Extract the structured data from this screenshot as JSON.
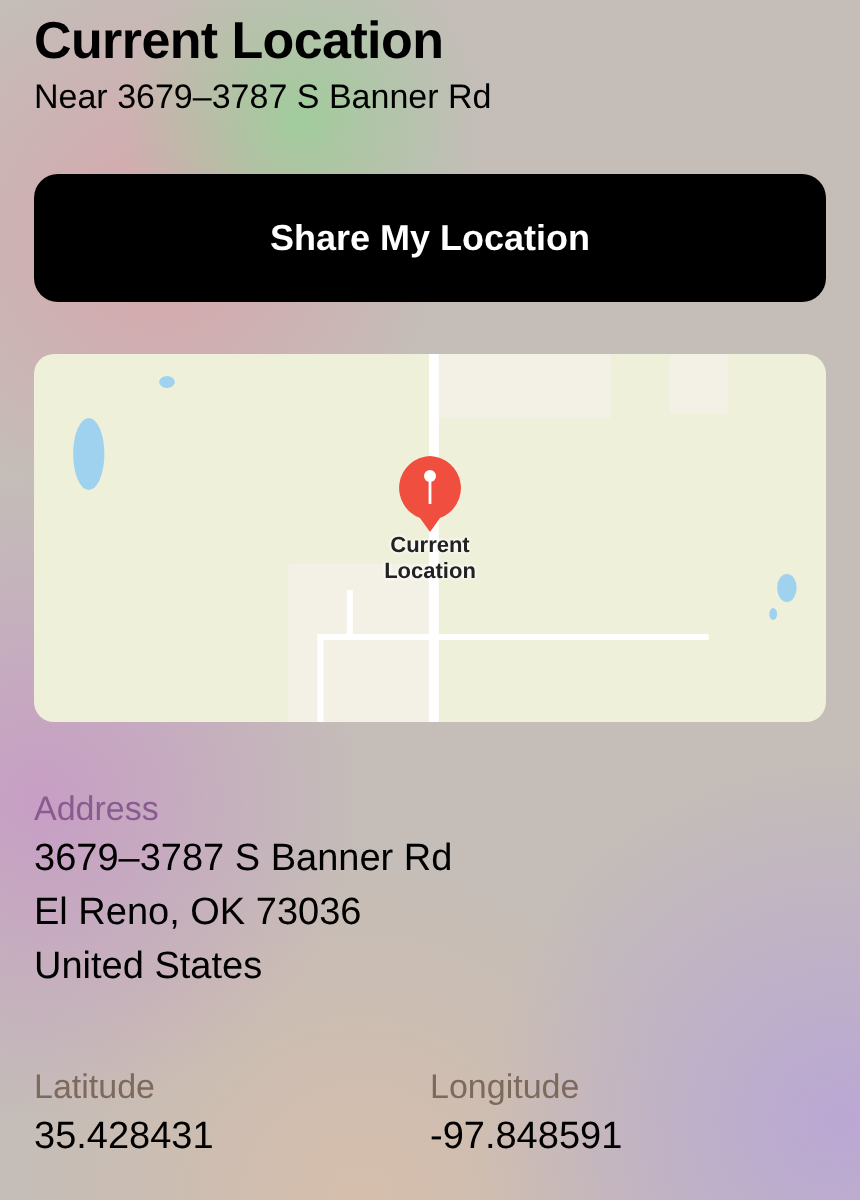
{
  "header": {
    "title": "Current Location",
    "subtitle": "Near 3679–3787 S Banner Rd"
  },
  "share_button": {
    "label": "Share My Location"
  },
  "map": {
    "kind": "picture",
    "pin_label": "Current Location"
  },
  "address": {
    "label": "Address",
    "lines": [
      "3679–3787 S Banner Rd",
      "El Reno, OK  73036",
      "United States"
    ]
  },
  "coordinates": [
    {
      "label": "Latitude",
      "value": "35.428431"
    },
    {
      "label": "Longitude",
      "value": "-97.848591"
    }
  ]
}
